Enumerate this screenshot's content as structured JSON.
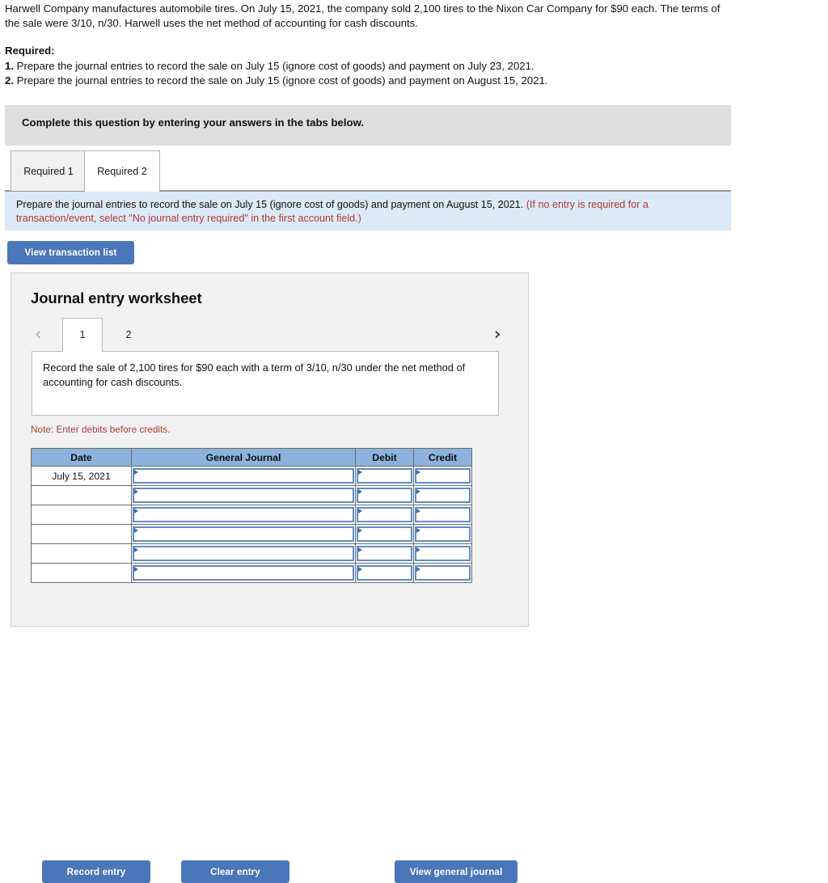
{
  "problem": {
    "paragraph": "Harwell Company manufactures automobile tires. On July 15, 2021, the company sold 2,100 tires to the Nixon Car Company for $90 each. The terms of the sale were 3/10, n/30. Harwell uses the net method of accounting for cash discounts.",
    "required_heading": "Required:",
    "requirements": [
      {
        "num": "1.",
        "text": " Prepare the journal entries to record the sale on July 15 (ignore cost of goods) and payment on July 23, 2021."
      },
      {
        "num": "2.",
        "text": " Prepare the journal entries to record the sale on July 15 (ignore cost of goods) and payment on August 15, 2021."
      }
    ]
  },
  "banner": {
    "text": "Complete this question by entering your answers in the tabs below."
  },
  "tabs": [
    {
      "label": "Required 1",
      "active": false
    },
    {
      "label": "Required 2",
      "active": true
    }
  ],
  "instruction": {
    "black_text": "Prepare the journal entries to record the sale on July 15 (ignore cost of goods) and payment on August 15, 2021. ",
    "red_text": "(If no entry is required for a transaction/event, select \"No journal entry required\" in the first account field.)"
  },
  "buttons": {
    "view_transaction_list": "View transaction list",
    "record_entry": "Record entry",
    "clear_entry": "Clear entry",
    "view_general_journal": "View general journal"
  },
  "worksheet": {
    "title": "Journal entry worksheet",
    "pager": {
      "prev_icon": "chevron-left",
      "next_icon": "chevron-right",
      "pages": [
        {
          "label": "1",
          "active": true
        },
        {
          "label": "2",
          "active": false
        }
      ]
    },
    "description": "Record the sale of 2,100 tires for $90 each with a term of 3/10, n/30 under the net method of accounting for cash discounts.",
    "note": "Note: Enter debits before credits.",
    "table": {
      "headers": [
        "Date",
        "General Journal",
        "Debit",
        "Credit"
      ],
      "rows": [
        {
          "date": "July 15, 2021",
          "general_journal": "",
          "debit": "",
          "credit": ""
        },
        {
          "date": "",
          "general_journal": "",
          "debit": "",
          "credit": ""
        },
        {
          "date": "",
          "general_journal": "",
          "debit": "",
          "credit": ""
        },
        {
          "date": "",
          "general_journal": "",
          "debit": "",
          "credit": ""
        },
        {
          "date": "",
          "general_journal": "",
          "debit": "",
          "credit": ""
        },
        {
          "date": "",
          "general_journal": "",
          "debit": "",
          "credit": ""
        }
      ]
    }
  },
  "colors": {
    "button_blue": "#4a77b9",
    "table_header_blue": "#8cb2dd",
    "instruction_band": "#dce9f7",
    "banner_gray": "#dedede",
    "red_text": "#b03a32",
    "cell_border_blue": "#5e8cc4"
  }
}
